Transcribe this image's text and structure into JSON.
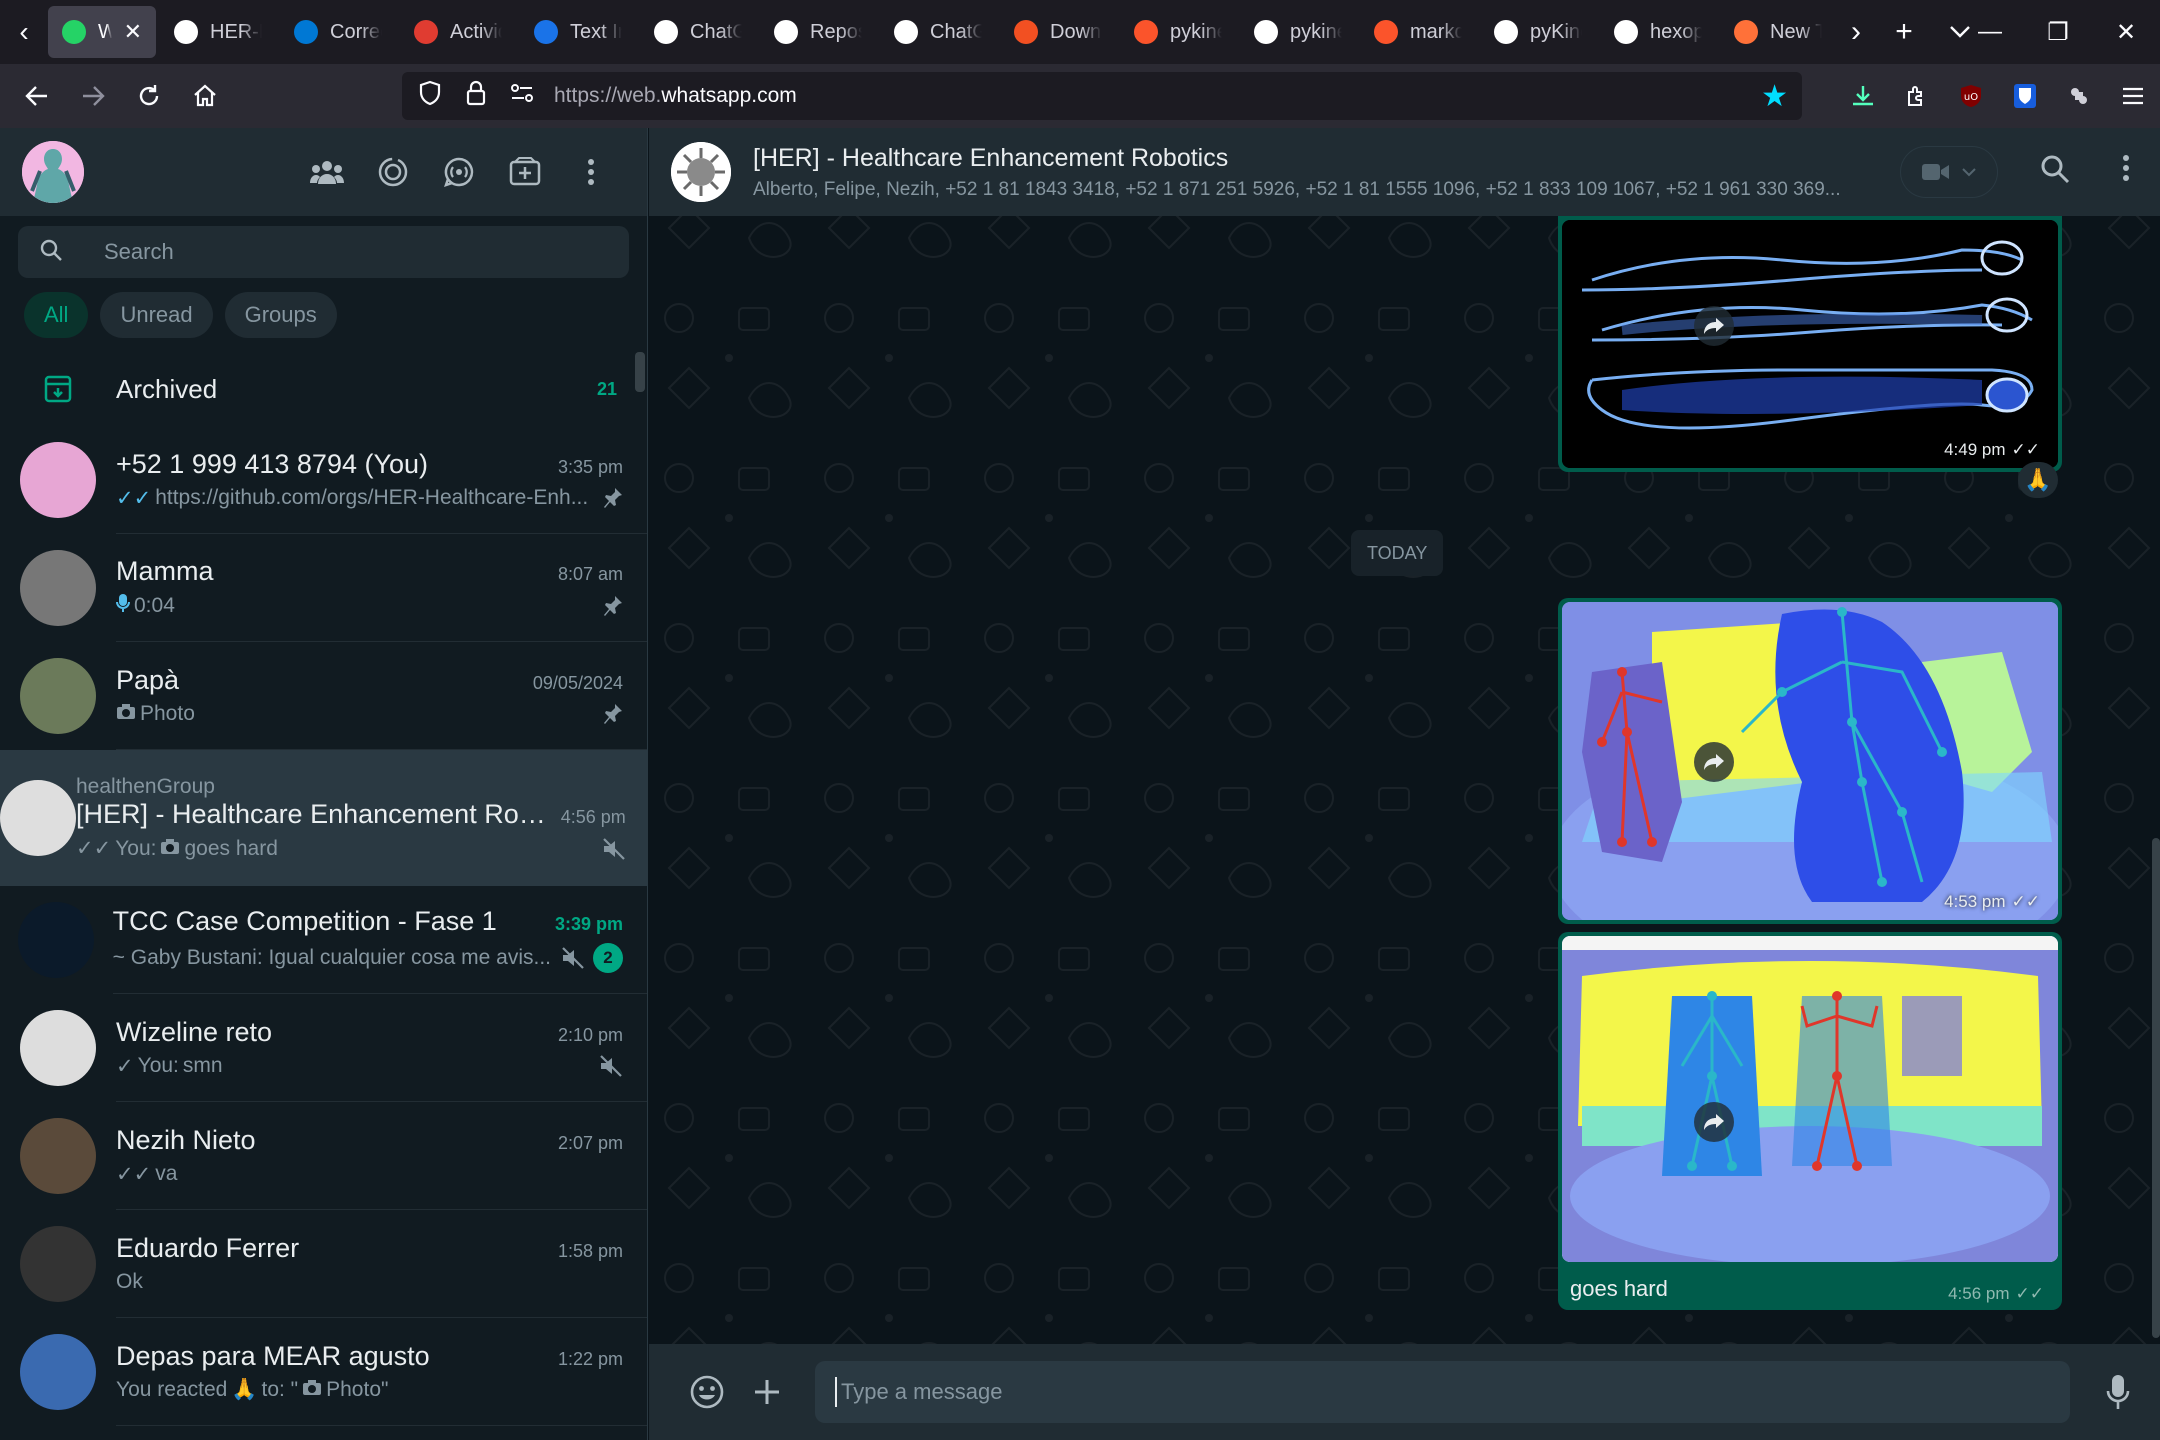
{
  "browser": {
    "tabs": [
      {
        "title": "WhatsApp",
        "active": true,
        "icon": "whatsapp-icon",
        "color": "#25d366"
      },
      {
        "title": "HER-Healthcare",
        "icon": "github-icon",
        "color": "#ffffff"
      },
      {
        "title": "Correo",
        "icon": "outlook-icon",
        "color": "#0078d4"
      },
      {
        "title": "Actividad",
        "icon": "activity-icon",
        "color": "#e03c31"
      },
      {
        "title": "Text Input",
        "icon": "c-icon",
        "color": "#1a73e8"
      },
      {
        "title": "ChatGPT",
        "icon": "chatgpt-icon",
        "color": "#ffffff"
      },
      {
        "title": "Repositories",
        "icon": "github-icon",
        "color": "#ffffff"
      },
      {
        "title": "ChatGPT",
        "icon": "chatgpt-icon",
        "color": "#ffffff"
      },
      {
        "title": "Download",
        "icon": "microsoft-icon",
        "color": "#f25022"
      },
      {
        "title": "pykinect",
        "icon": "brave-icon",
        "color": "#fb542b"
      },
      {
        "title": "pykinect",
        "icon": "box-icon",
        "color": "#ffffff"
      },
      {
        "title": "markdown",
        "icon": "brave-icon",
        "color": "#fb542b"
      },
      {
        "title": "pyKinect",
        "icon": "github-icon",
        "color": "#ffffff"
      },
      {
        "title": "hexops",
        "icon": "github-icon",
        "color": "#ffffff"
      },
      {
        "title": "New Tab",
        "icon": "firefox-icon",
        "color": "#ff7139"
      }
    ],
    "url_prefix": "https://web.",
    "url_domain": "whatsapp.com"
  },
  "sidebar": {
    "search_placeholder": "Search",
    "filters": [
      "All",
      "Unread",
      "Groups"
    ],
    "archived": {
      "label": "Archived",
      "count": "21"
    },
    "chats": [
      {
        "name": "+52 1 999 413 8794 (You)",
        "time": "3:35 pm",
        "preview": "https://github.com/orgs/HER-Healthcare-Enh...",
        "tick": "✓✓",
        "tick_color": "#53bdeb",
        "pinned": true
      },
      {
        "name": "Mamma",
        "time": "8:07 am",
        "preview": "0:04",
        "mic": true,
        "pinned": true
      },
      {
        "name": "Papà",
        "time": "09/05/2024",
        "preview": "Photo",
        "camera": true,
        "pinned": true
      },
      {
        "group": "healthenGroup",
        "name": "[HER] - Healthcare Enhancement Robot...",
        "time": "4:56 pm",
        "preview_prefix": "You:",
        "preview": "goes hard",
        "tick": "✓✓",
        "camera": true,
        "muted": true,
        "selected": true
      },
      {
        "name": "TCC Case Competition - Fase 1",
        "time": "3:39 pm",
        "preview": "~ Gaby Bustani: Igual cualquier cosa me avis...",
        "muted": true,
        "unread": "2",
        "time_green": true
      },
      {
        "name": "Wizeline reto",
        "time": "2:10 pm",
        "preview_prefix": "You:",
        "preview": "smn",
        "tick": "✓",
        "muted": true
      },
      {
        "name": "Nezih Nieto",
        "time": "2:07 pm",
        "preview": "va",
        "tick": "✓✓"
      },
      {
        "name": "Eduardo Ferrer",
        "time": "1:58 pm",
        "preview": "Ok"
      },
      {
        "name": "Depas para MEAR agusto",
        "time": "1:22 pm",
        "preview_prefix": "You reacted",
        "reaction": "🙏",
        "preview": "to: \"",
        "preview_suffix": "Photo\"",
        "camera": true
      }
    ]
  },
  "conversation": {
    "title": "[HER] - Healthcare Enhancement Robotics",
    "members": "Alberto, Felipe, Nezih, +52 1 81 1843 3418, +52 1 871 251 5926, +52 1 81 1555 1096, +52 1 833 109 1067, +52 1 961 330 369...",
    "day_separator": "TODAY",
    "messages": [
      {
        "time": "4:49 pm",
        "ticks": "✓✓",
        "reaction": "🙏",
        "image": "xray-bodies"
      },
      {
        "time": "4:53 pm",
        "ticks": "✓✓",
        "image": "depth-skeleton-1"
      },
      {
        "time": "4:56 pm",
        "ticks": "✓✓",
        "image": "depth-skeleton-2",
        "caption": "goes hard"
      }
    ],
    "input_placeholder": "Type a message"
  }
}
